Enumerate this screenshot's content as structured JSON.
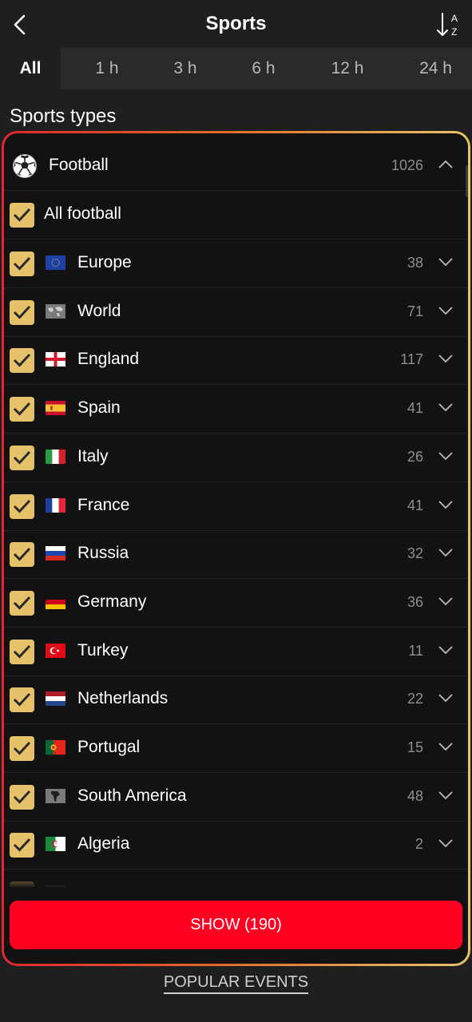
{
  "header": {
    "title": "Sports",
    "back_icon": "back-arrow-icon",
    "sort_icon": "sort-az-icon",
    "sort_letters": [
      "A",
      "Z"
    ]
  },
  "tabs": [
    {
      "label": "All",
      "active": true
    },
    {
      "label": "1 h",
      "active": false
    },
    {
      "label": "3 h",
      "active": false
    },
    {
      "label": "6 h",
      "active": false
    },
    {
      "label": "12 h",
      "active": false
    },
    {
      "label": "24 h",
      "active": false
    }
  ],
  "section_title": "Sports types",
  "sport": {
    "label": "Football",
    "count": "1026",
    "icon": "football-icon",
    "expanded": true
  },
  "all_row": {
    "label": "All football",
    "checked": true
  },
  "countries": [
    {
      "label": "Europe",
      "count": "38",
      "flag": "eu",
      "checked": true
    },
    {
      "label": "World",
      "count": "71",
      "flag": "world",
      "checked": true
    },
    {
      "label": "England",
      "count": "117",
      "flag": "england",
      "checked": true
    },
    {
      "label": "Spain",
      "count": "41",
      "flag": "spain",
      "checked": true
    },
    {
      "label": "Italy",
      "count": "26",
      "flag": "italy",
      "checked": true
    },
    {
      "label": "France",
      "count": "41",
      "flag": "france",
      "checked": true
    },
    {
      "label": "Russia",
      "count": "32",
      "flag": "russia",
      "checked": true
    },
    {
      "label": "Germany",
      "count": "36",
      "flag": "germany",
      "checked": true
    },
    {
      "label": "Turkey",
      "count": "11",
      "flag": "turkey",
      "checked": true
    },
    {
      "label": "Netherlands",
      "count": "22",
      "flag": "netherlands",
      "checked": true
    },
    {
      "label": "Portugal",
      "count": "15",
      "flag": "portugal",
      "checked": true
    },
    {
      "label": "South America",
      "count": "48",
      "flag": "south-america",
      "checked": true
    },
    {
      "label": "Algeria",
      "count": "2",
      "flag": "algeria",
      "checked": true
    }
  ],
  "show_button": {
    "label": "SHOW (190)"
  },
  "popular_link": {
    "label": "POPULAR EVENTS"
  },
  "colors": {
    "accent": "#ff0023",
    "checkbox": "#e5c26a",
    "panel_border_start": "#e1262f",
    "panel_border_end": "#e8c36a"
  }
}
